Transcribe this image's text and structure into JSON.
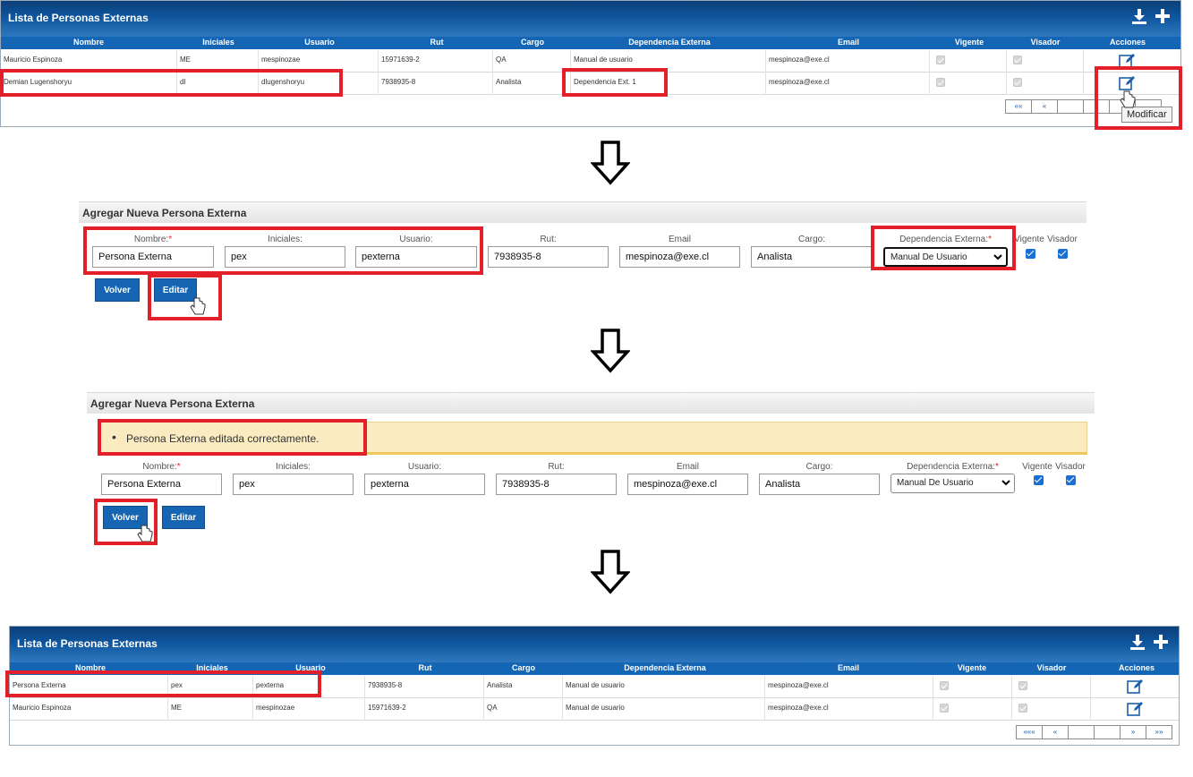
{
  "table": {
    "title": "Lista de Personas Externas",
    "columns": [
      "Nombre",
      "Iniciales",
      "Usuario",
      "Rut",
      "Cargo",
      "Dependencia Externa",
      "Email",
      "Vigente",
      "Visador",
      "Acciones"
    ],
    "rows_before": [
      {
        "nombre": "Mauricio Espinoza",
        "iniciales": "ME",
        "usuario": "mespinozae",
        "rut": "15971639-2",
        "cargo": "QA",
        "dependencia": "Manual de usuario",
        "email": "mespinoza@exe.cl"
      },
      {
        "nombre": "Demian Lugenshoryu",
        "iniciales": "dl",
        "usuario": "dlugenshoryu",
        "rut": "7938935-8",
        "cargo": "Analista",
        "dependencia": "Dependencia Ext. 1",
        "email": "mespinoza@exe.cl"
      }
    ],
    "rows_after": [
      {
        "nombre": "Persona Externa",
        "iniciales": "pex",
        "usuario": "pexterna",
        "rut": "7938935-8",
        "cargo": "Analista",
        "dependencia": "Manual de usuario",
        "email": "mespinoza@exe.cl"
      },
      {
        "nombre": "Mauricio Espinoza",
        "iniciales": "ME",
        "usuario": "mespinozae",
        "rut": "15971639-2",
        "cargo": "QA",
        "dependencia": "Manual de usuario",
        "email": "mespinoza@exe.cl"
      }
    ],
    "pager": [
      "«««",
      "«",
      "",
      "",
      "»",
      "»»"
    ],
    "pager_top": [
      "««",
      "«",
      "",
      "",
      "",
      ""
    ],
    "tooltip": "Modificar"
  },
  "form": {
    "title": "Agregar Nueva Persona Externa",
    "labels": {
      "nombre": "Nombre:",
      "iniciales": "Iniciales:",
      "usuario": "Usuario:",
      "rut": "Rut:",
      "email": "Email",
      "cargo": "Cargo:",
      "dependencia": "Dependencia Externa:",
      "vigente": "Vigente",
      "visador": "Visador"
    },
    "required_mark": "*",
    "values": {
      "nombre": "Persona Externa",
      "iniciales": "pex",
      "usuario": "pexterna",
      "rut": "7938935-8",
      "email": "mespinoza@exe.cl",
      "cargo": "Analista",
      "dependencia": "Manual De Usuario"
    },
    "buttons": {
      "volver": "Volver",
      "editar": "Editar"
    },
    "success_message": "Persona Externa editada correctamente."
  },
  "colors": {
    "header_blue": "#0e559d",
    "highlight_red": "#e3202a",
    "button_blue": "#1565b2"
  }
}
